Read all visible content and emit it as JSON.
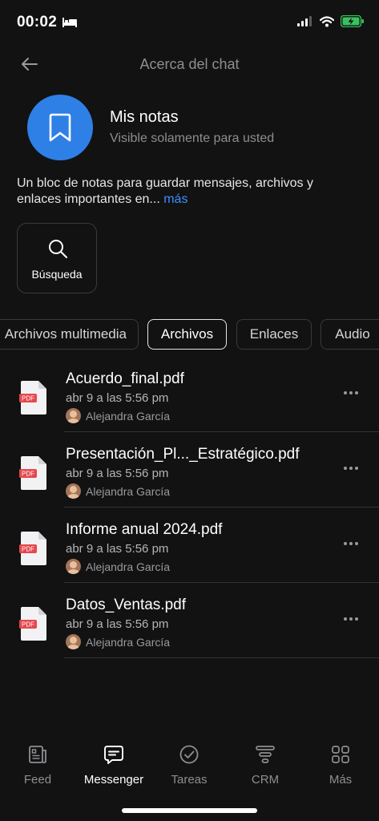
{
  "status_bar": {
    "time": "00:02"
  },
  "header": {
    "title": "Acerca del chat"
  },
  "profile": {
    "name": "Mis notas",
    "subtitle": "Visible solamente para usted"
  },
  "description": {
    "text": "Un bloc de notas para guardar mensajes, archivos y enlaces importantes en...",
    "more_label": "más"
  },
  "search_action": {
    "label": "Búsqueda"
  },
  "tabs": [
    {
      "label": "Archivos multimedia",
      "active": false
    },
    {
      "label": "Archivos",
      "active": true
    },
    {
      "label": "Enlaces",
      "active": false
    },
    {
      "label": "Audio",
      "active": false
    }
  ],
  "files": [
    {
      "name": "Acuerdo_final.pdf",
      "date": "abr 9 a las 5:56 pm",
      "author": "Alejandra García",
      "badge": "PDF"
    },
    {
      "name": "Presentación_Pl..._Estratégico.pdf",
      "date": "abr 9 a las 5:56 pm",
      "author": "Alejandra García",
      "badge": "PDF"
    },
    {
      "name": "Informe anual 2024.pdf",
      "date": "abr 9 a las 5:56 pm",
      "author": "Alejandra García",
      "badge": "PDF"
    },
    {
      "name": "Datos_Ventas.pdf",
      "date": "abr 9 a las 5:56 pm",
      "author": "Alejandra García",
      "badge": "PDF"
    }
  ],
  "bottom_nav": [
    {
      "label": "Feed",
      "icon": "feed-icon",
      "active": false
    },
    {
      "label": "Messenger",
      "icon": "chat-icon",
      "active": true
    },
    {
      "label": "Tareas",
      "icon": "check-circle-icon",
      "active": false
    },
    {
      "label": "CRM",
      "icon": "funnel-icon",
      "active": false
    },
    {
      "label": "Más",
      "icon": "grid-icon",
      "active": false
    }
  ],
  "colors": {
    "accent": "#2f80e6",
    "link": "#3a8fff",
    "background": "#121212",
    "pdf_badge": "#e5484d"
  }
}
